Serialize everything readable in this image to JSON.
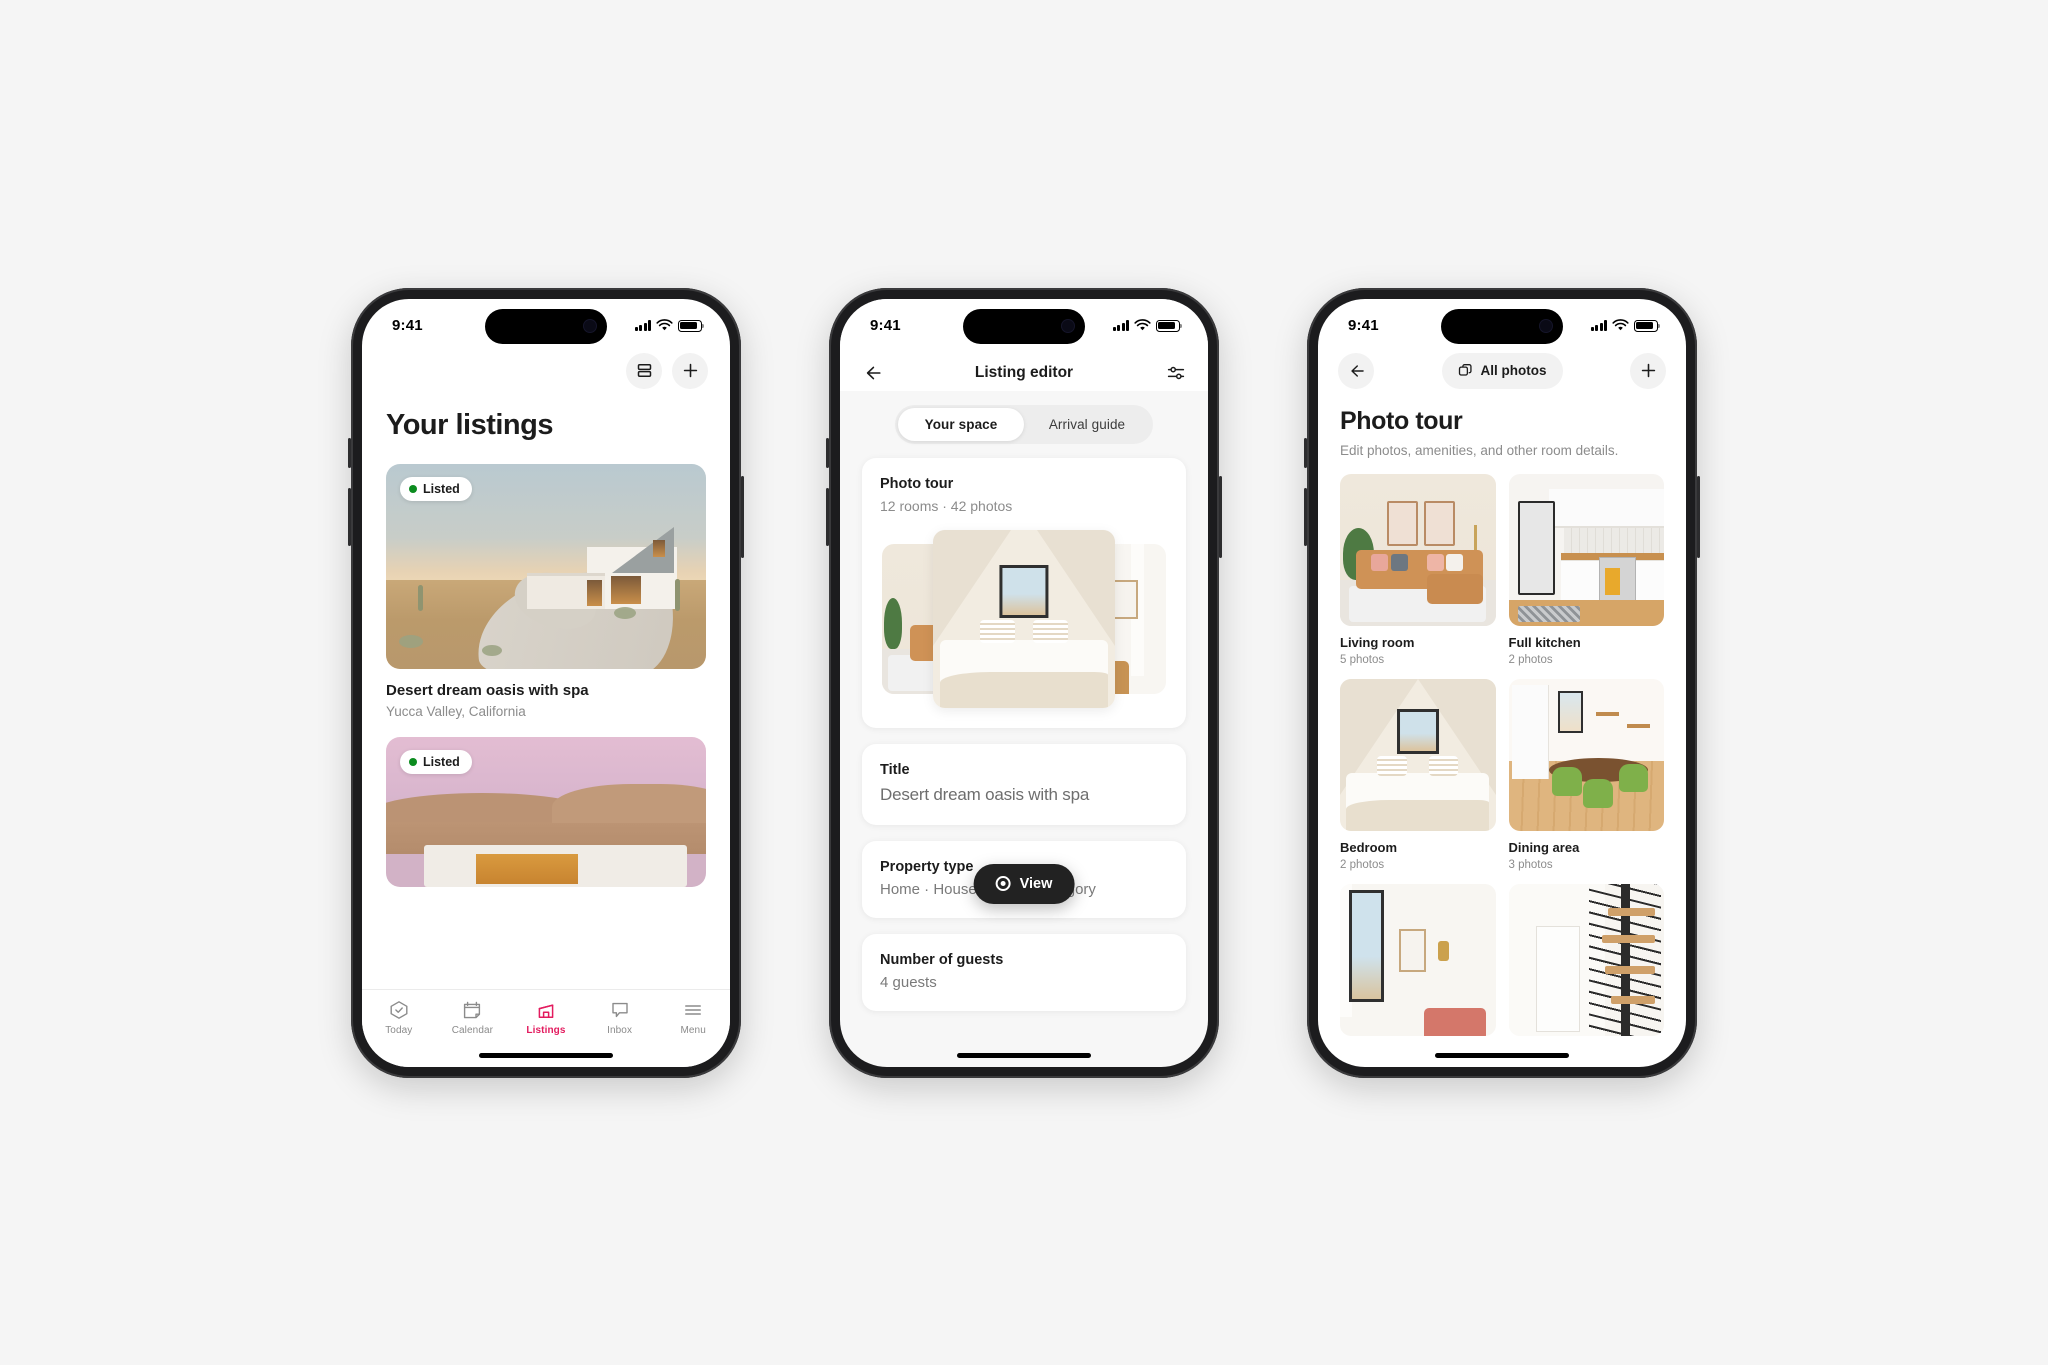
{
  "statusbar": {
    "time": "9:41"
  },
  "phone1": {
    "header": {
      "layout_toggle_icon": "layout-rows-icon",
      "add_icon": "plus-icon"
    },
    "page_title": "Your listings",
    "listings": [
      {
        "badge": "Listed",
        "name": "Desert dream oasis with spa",
        "location": "Yucca Valley, California"
      },
      {
        "badge": "Listed",
        "name": "",
        "location": ""
      }
    ],
    "tabs": [
      {
        "label": "Today",
        "icon": "shield-check-icon",
        "active": false
      },
      {
        "label": "Calendar",
        "icon": "calendar-icon",
        "active": false
      },
      {
        "label": "Listings",
        "icon": "house-icon",
        "active": true
      },
      {
        "label": "Inbox",
        "icon": "chat-bubble-icon",
        "active": false
      },
      {
        "label": "Menu",
        "icon": "hamburger-icon",
        "active": false
      }
    ],
    "accent_color": "#e31c5f"
  },
  "phone2": {
    "nav": {
      "back_icon": "back-arrow-icon",
      "title": "Listing editor",
      "settings_icon": "sliders-icon"
    },
    "segments": [
      {
        "label": "Your space",
        "active": true
      },
      {
        "label": "Arrival guide",
        "active": false
      }
    ],
    "cards": [
      {
        "heading": "Photo tour",
        "sub": "12 rooms · 42 photos"
      },
      {
        "heading": "Title",
        "value": "Desert dream oasis with spa"
      },
      {
        "heading": "Property type",
        "sub": "Home · House · Desert category"
      },
      {
        "heading": "Number of guests",
        "sub": "4 guests"
      }
    ],
    "fab": {
      "label": "View",
      "icon": "eye-icon"
    }
  },
  "phone3": {
    "nav": {
      "back_icon": "back-arrow-icon",
      "all_photos_label": "All photos",
      "all_photos_icon": "photos-stack-icon",
      "add_icon": "plus-icon"
    },
    "title": "Photo tour",
    "subtitle": "Edit photos, amenities, and other room details.",
    "rooms": [
      {
        "name": "Living room",
        "count": "5 photos",
        "art": "living"
      },
      {
        "name": "Full kitchen",
        "count": "2 photos",
        "art": "kitchen"
      },
      {
        "name": "Bedroom",
        "count": "2 photos",
        "art": "bed"
      },
      {
        "name": "Dining area",
        "count": "3 photos",
        "art": "dining"
      },
      {
        "name": "",
        "count": "",
        "art": "hall"
      },
      {
        "name": "",
        "count": "",
        "art": "stair"
      }
    ]
  }
}
